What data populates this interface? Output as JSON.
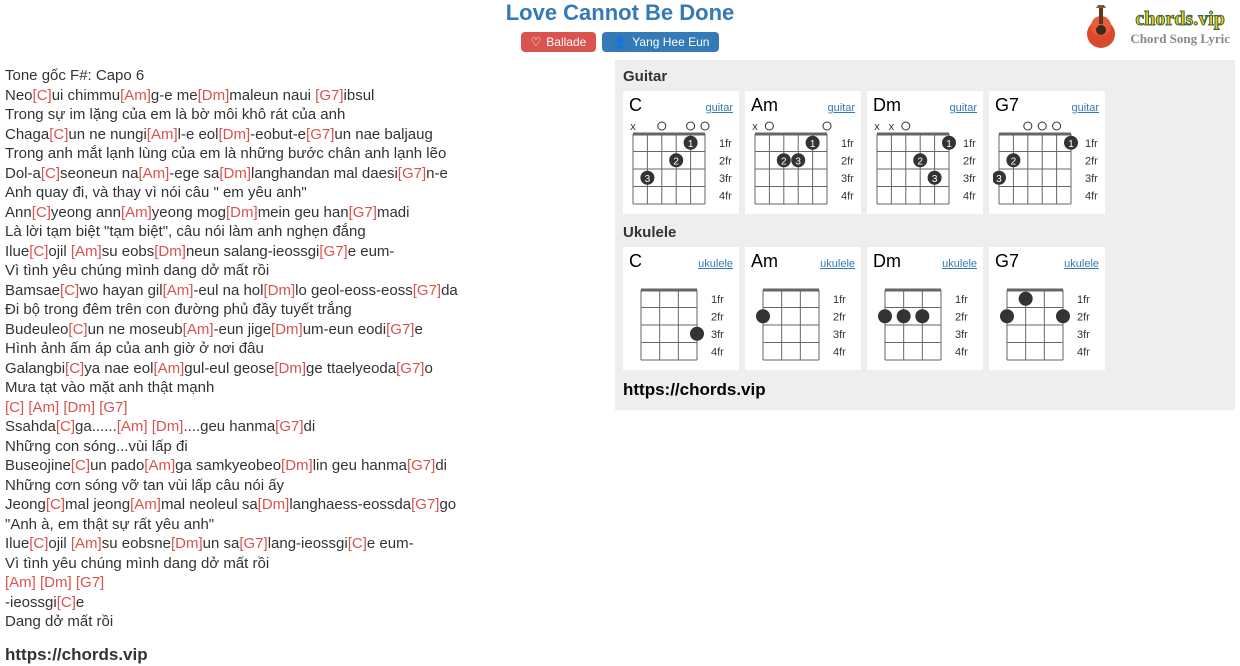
{
  "header": {
    "title": "Love Cannot Be Done",
    "genre_label": "Ballade",
    "artist_label": "Yang Hee Eun"
  },
  "logo": {
    "line1": "chords.vip",
    "line2": "Chord Song Lyric"
  },
  "lyrics": {
    "lines": [
      "Tone gốc F#: Capo 6",
      "Neo|[C]|ui chimmu|[Am]|g-e me|[Dm]|maleun naui |[G7]|ibsul",
      "Trong sự im lặng của em là bờ môi khô rát của anh",
      "Chaga|[C]|un ne nungi|[Am]|l-e eol|[Dm]|-eobut-e|[G7]|un nae baljaug",
      "Trong anh mắt lạnh lùng của em là những bước chân anh lạnh lẽo",
      "Dol-a|[C]|seoneun na|[Am]|-ege sa|[Dm]|langhandan mal daesi|[G7]|n-e",
      "Anh quay đi, và thay vì nói câu \" em yêu anh\"",
      "Ann|[C]|yeong ann|[Am]|yeong mog|[Dm]|mein geu han|[G7]|madi",
      "Là lời tạm biệt \"tạm biệt\", câu nói làm anh nghẹn đắng",
      "Ilue|[C]|ojil |[Am]|su eobs|[Dm]|neun salang-ieossgi|[G7]|e eum-",
      "Vì tình yêu chúng mình dang dở mất rồi",
      "Bamsae|[C]|wo hayan gil|[Am]|-eul na hol|[Dm]|lo geol-eoss-eoss|[G7]|da",
      "Đi bộ trong đêm trên con đường phủ đầy tuyết trắng",
      "Budeuleo|[C]|un ne moseub|[Am]|-eun jige|[Dm]|um-eun eodi|[G7]|e",
      "Hình ảnh ấm áp của anh giờ ở nơi đâu",
      "Galangbi|[C]|ya nae eol|[Am]|gul-eul geose|[Dm]|ge ttaelyeoda|[G7]|o",
      "Mưa tạt vào mặt anh thật mạnh",
      "|[C]| |[Am]| |[Dm]| |[G7]|",
      "Ssahda|[C]|ga......|[Am]| |[Dm]|....geu hanma|[G7]|di",
      "Những con sóng...vùi lấp đi",
      "Buseojine|[C]|un pado|[Am]|ga samkyeobeo|[Dm]|lin geu hanma|[G7]|di",
      "Những cơn sóng vỡ tan vùi lấp câu nói ấy",
      "Jeong|[C]|mal jeong|[Am]|mal neoleul sa|[Dm]|langhaess-eossda|[G7]|go",
      "\"Anh à, em thật sự rất yêu anh\"",
      "Ilue|[C]|ojil |[Am]|su eobsne|[Dm]|un sa|[G7]|lang-ieossgi|[C]|e eum-",
      "Vì tình yêu chúng mình dang dở mất rồi",
      "|[Am]| |[Dm]| |[G7]|",
      "-ieossgi|[C]|e",
      "Dang dở mất rồi"
    ],
    "footer_url": "https://chords.vip"
  },
  "sidebar": {
    "guitar_title": "Guitar",
    "ukulele_title": "Ukulele",
    "site_url": "https://chords.vip",
    "chords": [
      "C",
      "Am",
      "Dm",
      "G7"
    ],
    "guitar_label": "guitar",
    "ukulele_label": "ukulele",
    "fret_labels": [
      "1fr",
      "2fr",
      "3fr",
      "4fr"
    ],
    "guitar_diagrams": {
      "C": {
        "open": [
          0,
          0,
          1,
          0,
          1,
          1
        ],
        "mute": [
          1,
          0,
          0,
          0,
          0,
          0
        ],
        "dots": [
          [
            4,
            1,
            1
          ],
          [
            3,
            2,
            2
          ],
          [
            1,
            3,
            3
          ]
        ]
      },
      "Am": {
        "open": [
          0,
          1,
          0,
          0,
          0,
          1
        ],
        "mute": [
          1,
          0,
          0,
          0,
          0,
          0
        ],
        "dots": [
          [
            4,
            1,
            1
          ],
          [
            2,
            2,
            2
          ],
          [
            3,
            2,
            3
          ]
        ]
      },
      "Dm": {
        "open": [
          0,
          0,
          1,
          0,
          0,
          0
        ],
        "mute": [
          1,
          1,
          0,
          0,
          0,
          0
        ],
        "dots": [
          [
            5,
            1,
            1
          ],
          [
            3,
            2,
            2
          ],
          [
            4,
            3,
            3
          ]
        ]
      },
      "G7": {
        "open": [
          0,
          0,
          1,
          1,
          1,
          0
        ],
        "mute": [
          0,
          0,
          0,
          0,
          0,
          0
        ],
        "dots": [
          [
            5,
            1,
            1
          ],
          [
            1,
            2,
            2
          ],
          [
            0,
            3,
            3
          ]
        ]
      }
    },
    "ukulele_diagrams": {
      "C": {
        "dots": [
          [
            3,
            3,
            0
          ]
        ]
      },
      "Am": {
        "dots": [
          [
            0,
            2,
            0
          ]
        ]
      },
      "Dm": {
        "dots": [
          [
            1,
            2,
            0
          ],
          [
            0,
            2,
            0
          ],
          [
            2,
            2,
            0
          ]
        ]
      },
      "G7": {
        "dots": [
          [
            1,
            1,
            0
          ],
          [
            3,
            2,
            0
          ],
          [
            0,
            2,
            0
          ]
        ]
      }
    }
  }
}
